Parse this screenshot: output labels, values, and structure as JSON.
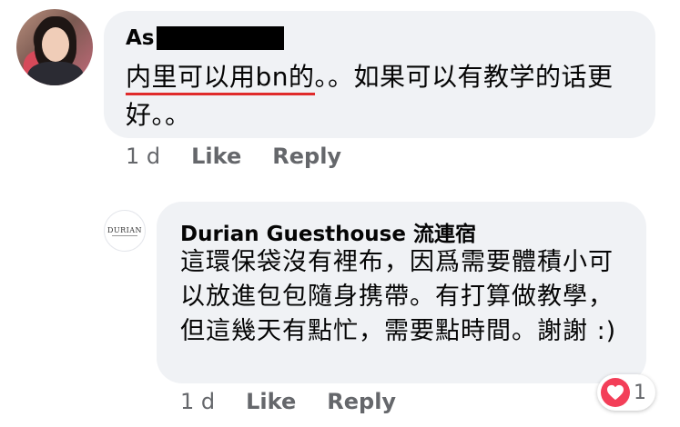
{
  "comment": {
    "author_visible": "As",
    "text_underlined": "内里可以用bn的",
    "text_rest": "。。如果可以有教学的话更好。。",
    "time": "1 d",
    "like_label": "Like",
    "reply_label": "Reply"
  },
  "reply": {
    "avatar_text": "DURIAN",
    "author": "Durian Guesthouse 流連宿",
    "text": "這環保袋沒有裡布，因爲需要體積小可以放進包包隨身携帶。有打算做教學，但這幾天有點忙，需要點時間。謝謝 :)",
    "time": "1 d",
    "like_label": "Like",
    "reply_label": "Reply",
    "reaction_count": "1"
  },
  "colors": {
    "bubble": "#f0f2f5",
    "meta_text": "#65676b",
    "underline": "#e02b2b",
    "heart": "#f33e58"
  },
  "icons": {
    "reaction": "heart-icon"
  }
}
